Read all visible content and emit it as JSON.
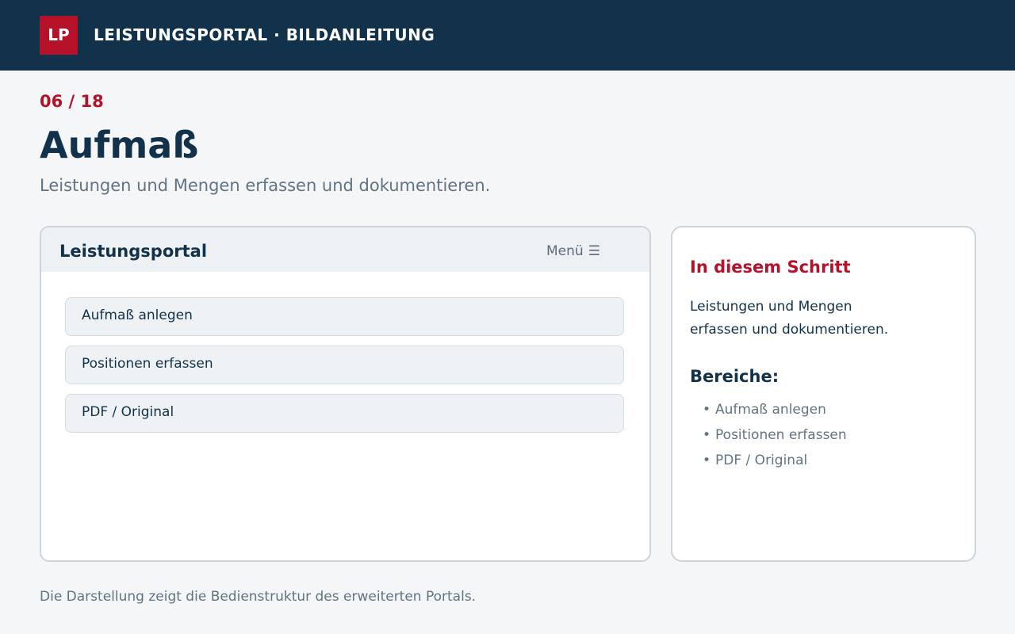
{
  "header": {
    "logo_text": "LP",
    "title": "LEISTUNGSPORTAL · BILDANLEITUNG",
    "background_color": "#12314a",
    "accent_color": "#b5122a"
  },
  "step": {
    "counter": "06 / 18",
    "title": "Aufmaß",
    "subtitle": "Leistungen und Mengen erfassen und dokumentieren."
  },
  "portal": {
    "title": "Leistungsportal",
    "menu_label": "Menü",
    "menu_icon": "☰",
    "items": [
      {
        "label": "Aufmaß anlegen"
      },
      {
        "label": "Positionen erfassen"
      },
      {
        "label": "PDF / Original"
      }
    ]
  },
  "sidebar": {
    "heading": "In diesem Schritt",
    "text_line1": "Leistungen und Mengen",
    "text_line2": "erfassen und dokumentieren.",
    "subheading": "Bereiche:",
    "bullet": "•",
    "areas": [
      "Aufmaß anlegen",
      "Positionen erfassen",
      "PDF / Original"
    ]
  },
  "footer": {
    "text": "Die Darstellung zeigt die Bedienstruktur des erweiterten Portals."
  }
}
